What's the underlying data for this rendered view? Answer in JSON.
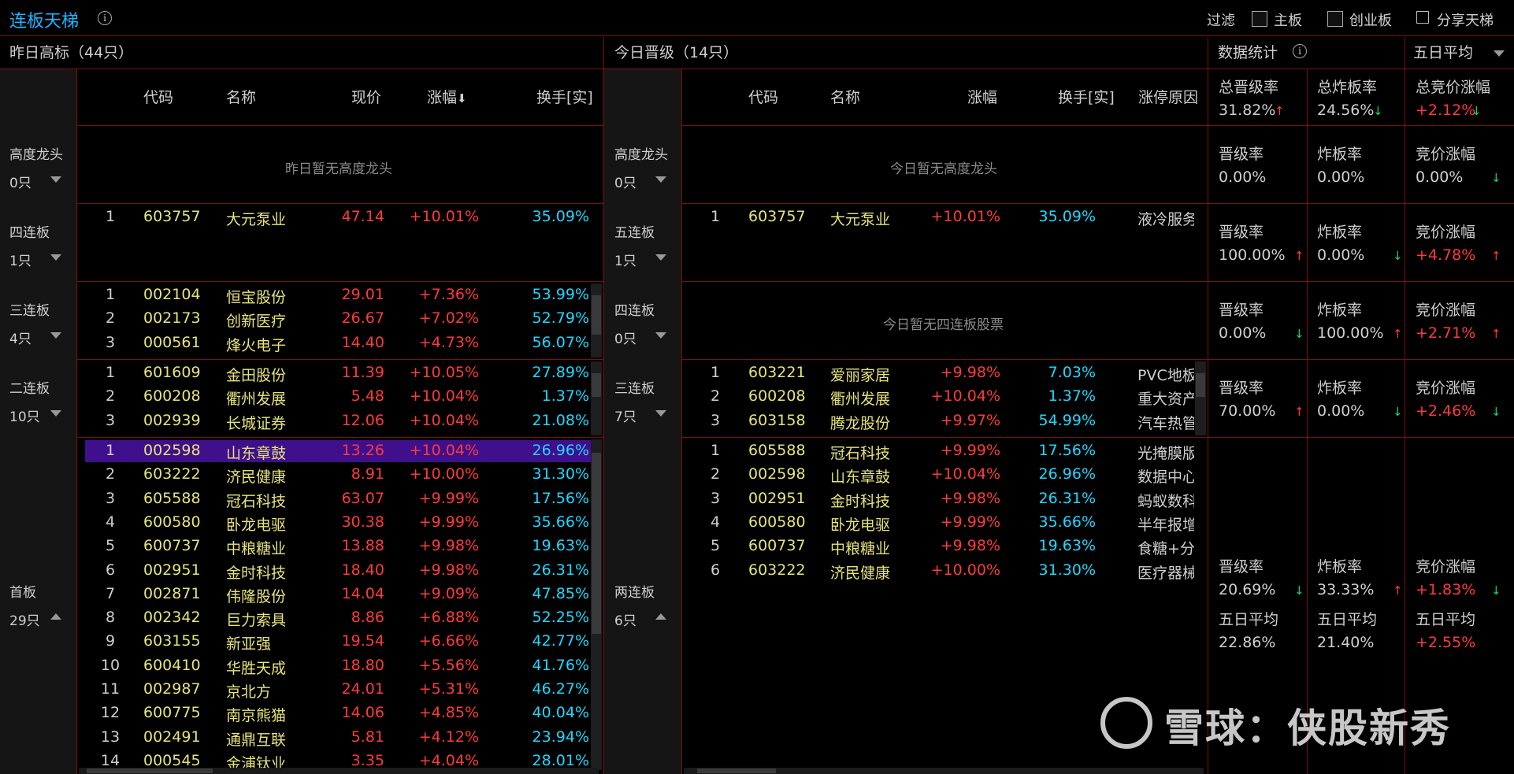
{
  "topbar": {
    "title": "连板天梯",
    "filter_label": "过滤",
    "main_board": "主板",
    "growth_board": "创业板",
    "share": "分享天梯",
    "avg_select": "五日平均"
  },
  "left": {
    "header": "昨日高标（44只）",
    "columns": [
      "代码",
      "名称",
      "现价",
      "涨幅",
      "换手[实]"
    ],
    "sections": [
      {
        "label": "高度龙头",
        "count": "0只",
        "empty_text": "昨日暂无高度龙头",
        "rows": []
      },
      {
        "label": "四连板",
        "count": "1只",
        "rows": [
          [
            "1",
            "603757",
            "大元泵业",
            "47.14",
            "+10.01%",
            "35.09%"
          ]
        ]
      },
      {
        "label": "三连板",
        "count": "4只",
        "rows": [
          [
            "1",
            "002104",
            "恒宝股份",
            "29.01",
            "+7.36%",
            "53.99%"
          ],
          [
            "2",
            "002173",
            "创新医疗",
            "26.67",
            "+7.02%",
            "52.79%"
          ],
          [
            "3",
            "000561",
            "烽火电子",
            "14.40",
            "+4.73%",
            "56.07%"
          ]
        ]
      },
      {
        "label": "二连板",
        "count": "10只",
        "rows": [
          [
            "1",
            "601609",
            "金田股份",
            "11.39",
            "+10.05%",
            "27.89%"
          ],
          [
            "2",
            "600208",
            "衢州发展",
            "5.48",
            "+10.04%",
            "1.37%"
          ],
          [
            "3",
            "002939",
            "长城证券",
            "12.06",
            "+10.04%",
            "21.08%"
          ]
        ]
      },
      {
        "label": "首板",
        "count": "29只",
        "rows": [
          [
            "1",
            "002598",
            "山东章鼓",
            "13.26",
            "+10.04%",
            "26.96%"
          ],
          [
            "2",
            "603222",
            "济民健康",
            "8.91",
            "+10.00%",
            "31.30%"
          ],
          [
            "3",
            "605588",
            "冠石科技",
            "63.07",
            "+9.99%",
            "17.56%"
          ],
          [
            "4",
            "600580",
            "卧龙电驱",
            "30.38",
            "+9.99%",
            "35.66%"
          ],
          [
            "5",
            "600737",
            "中粮糖业",
            "13.88",
            "+9.98%",
            "19.63%"
          ],
          [
            "6",
            "002951",
            "金时科技",
            "18.40",
            "+9.98%",
            "26.31%"
          ],
          [
            "7",
            "002871",
            "伟隆股份",
            "14.04",
            "+9.09%",
            "47.85%"
          ],
          [
            "8",
            "002342",
            "巨力索具",
            "8.86",
            "+6.88%",
            "52.25%"
          ],
          [
            "9",
            "603155",
            "新亚强",
            "19.54",
            "+6.66%",
            "42.77%"
          ],
          [
            "10",
            "600410",
            "华胜天成",
            "18.80",
            "+5.56%",
            "41.76%"
          ],
          [
            "11",
            "002987",
            "京北方",
            "24.01",
            "+5.31%",
            "46.27%"
          ],
          [
            "12",
            "600775",
            "南京熊猫",
            "14.06",
            "+4.85%",
            "40.04%"
          ],
          [
            "13",
            "002491",
            "通鼎互联",
            "5.81",
            "+4.12%",
            "23.94%"
          ],
          [
            "14",
            "000545",
            "金浦钛业",
            "3.35",
            "+4.04%",
            "28.01%"
          ]
        ]
      }
    ]
  },
  "mid": {
    "header": "今日晋级（14只）",
    "columns": [
      "代码",
      "名称",
      "涨幅",
      "换手[实]",
      "涨停原因"
    ],
    "sections": [
      {
        "label": "高度龙头",
        "count": "0只",
        "empty_text": "今日暂无高度龙头",
        "rows": []
      },
      {
        "label": "五连板",
        "count": "1只",
        "rows": [
          [
            "1",
            "603757",
            "大元泵业",
            "+10.01%",
            "35.09%",
            "液冷服务器"
          ]
        ]
      },
      {
        "label": "四连板",
        "count": "0只",
        "empty_text": "今日暂无四连板股票",
        "rows": []
      },
      {
        "label": "三连板",
        "count": "7只",
        "rows": [
          [
            "1",
            "603221",
            "爱丽家居",
            "+9.98%",
            "7.03%",
            "PVC地板"
          ],
          [
            "2",
            "600208",
            "衢州发展",
            "+10.04%",
            "1.37%",
            "重大资产"
          ],
          [
            "3",
            "603158",
            "腾龙股份",
            "+9.97%",
            "54.99%",
            "汽车热管"
          ]
        ]
      },
      {
        "label": "两连板",
        "count": "6只",
        "rows": [
          [
            "1",
            "605588",
            "冠石科技",
            "+9.99%",
            "17.56%",
            "光掩膜版"
          ],
          [
            "2",
            "002598",
            "山东章鼓",
            "+10.04%",
            "26.96%",
            "数据中心+"
          ],
          [
            "3",
            "002951",
            "金时科技",
            "+9.98%",
            "26.31%",
            "蚂蚁数科"
          ],
          [
            "4",
            "600580",
            "卧龙电驱",
            "+9.99%",
            "35.66%",
            "半年报增长"
          ],
          [
            "5",
            "600737",
            "中粮糖业",
            "+9.98%",
            "19.63%",
            "食糖+分红"
          ],
          [
            "6",
            "603222",
            "济民健康",
            "+10.00%",
            "31.30%",
            "医疗器械+"
          ]
        ]
      }
    ]
  },
  "stats": {
    "header": "数据统计",
    "summary": [
      {
        "label": "总晋级率",
        "value": "31.82%",
        "dir": "up"
      },
      {
        "label": "总炸板率",
        "value": "24.56%",
        "dir": "down"
      },
      {
        "label": "总竞价涨幅",
        "value": "+2.12%",
        "dir": "down"
      }
    ],
    "rows": [
      [
        {
          "label": "晋级率",
          "value": "0.00%",
          "dir": ""
        },
        {
          "label": "炸板率",
          "value": "0.00%",
          "dir": ""
        },
        {
          "label": "竞价涨幅",
          "value": "0.00%",
          "dir": "down"
        }
      ],
      [
        {
          "label": "晋级率",
          "value": "100.00%",
          "dir": "up"
        },
        {
          "label": "炸板率",
          "value": "0.00%",
          "dir": "down"
        },
        {
          "label": "竞价涨幅",
          "value": "+4.78%",
          "dir": "up"
        }
      ],
      [
        {
          "label": "晋级率",
          "value": "0.00%",
          "dir": "down"
        },
        {
          "label": "炸板率",
          "value": "100.00%",
          "dir": "up"
        },
        {
          "label": "竞价涨幅",
          "value": "+2.71%",
          "dir": "up"
        }
      ],
      [
        {
          "label": "晋级率",
          "value": "70.00%",
          "dir": "up"
        },
        {
          "label": "炸板率",
          "value": "0.00%",
          "dir": "down"
        },
        {
          "label": "竞价涨幅",
          "value": "+2.46%",
          "dir": "down"
        }
      ],
      [
        {
          "label": "晋级率",
          "value": "20.69%",
          "dir": "down"
        },
        {
          "label": "炸板率",
          "value": "33.33%",
          "dir": "up"
        },
        {
          "label": "竞价涨幅",
          "value": "+1.83%",
          "dir": "down"
        }
      ]
    ],
    "avg": [
      {
        "label": "五日平均",
        "value": "22.86%"
      },
      {
        "label": "五日平均",
        "value": "21.40%"
      },
      {
        "label": "五日平均",
        "value": "+2.55%"
      }
    ]
  },
  "watermark": "雪球：侠股新秀",
  "colors": {
    "red": "#ff3b3b",
    "cyan": "#1fd8ff",
    "yellow": "#e6e37a",
    "green": "#1fd16a",
    "border": "#7a1010",
    "highlight": "#3f0f8c",
    "title": "#1fb4ff"
  }
}
